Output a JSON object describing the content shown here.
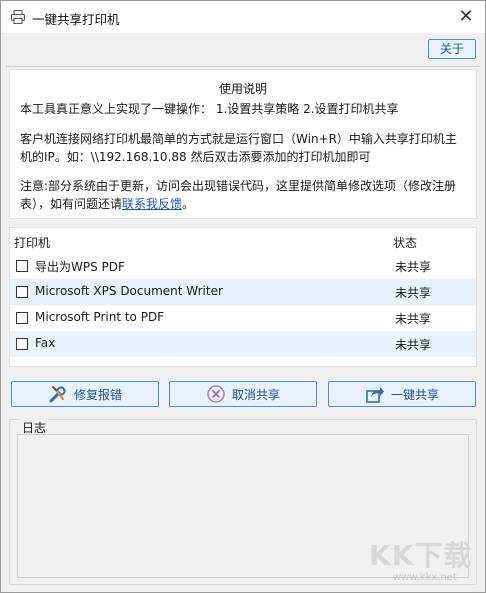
{
  "window": {
    "title": "一键共享打印机",
    "close_glyph": "✕"
  },
  "toolbar": {
    "about_label": "关于"
  },
  "instructions": {
    "title": "使用说明",
    "p1": "本工具真正意义上实现了一键操作：  1.设置共享策略  2.设置打印机共享",
    "p2_line1": "客户机连接网络打印机最简单的方式就是运行窗口（Win+R）中输入共享打印机主",
    "p2_line2": "机的IP。如：\\\\192.168.10.88 然后双击添要添加的打印机加即可",
    "p3_line1": "注意:部分系统由于更新，访问会出现错误代码，这里提供简单修改选项（修改注册",
    "p3_line2_prefix": "表），如有问题还请",
    "p3_link": "联系我反馈",
    "p3_suffix": "。"
  },
  "printers": {
    "header_name": "打印机",
    "header_status": "状态",
    "rows": [
      {
        "name": "导出为WPS PDF",
        "status": "未共享",
        "checked": false
      },
      {
        "name": "Microsoft XPS Document Writer",
        "status": "未共享",
        "checked": false
      },
      {
        "name": "Microsoft Print to PDF",
        "status": "未共享",
        "checked": false
      },
      {
        "name": "Fax",
        "status": "未共享",
        "checked": false
      }
    ]
  },
  "actions": {
    "repair_label": "修复报错",
    "repair_icon": "wrench-screwdriver-icon",
    "cancel_label": "取消共享",
    "cancel_icon": "cancel-circle-icon",
    "share_label": "一键共享",
    "share_icon": "share-arrow-icon"
  },
  "log": {
    "label": "日志",
    "content": ""
  },
  "watermark": {
    "logo": "KK下载",
    "site": "www.kkx.net"
  },
  "colors": {
    "accent_border": "#4a90d9",
    "button_bg": "#e8f1fc",
    "row_alt": "#e6f1fb",
    "link": "#1a56b8"
  }
}
